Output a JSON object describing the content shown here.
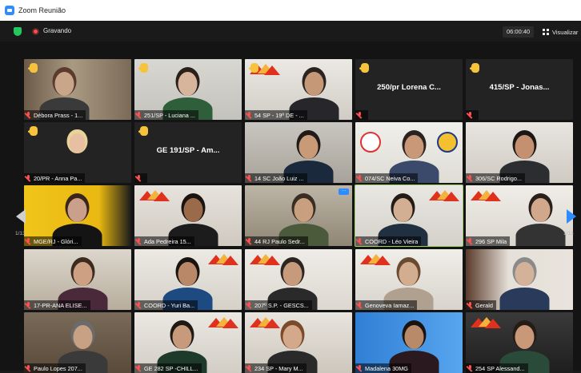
{
  "window": {
    "title": "Zoom Reunião"
  },
  "topbar": {
    "recording_label": "Gravando",
    "timer": "06:00:40",
    "view_label": "Visualizar"
  },
  "pagination": {
    "left": "1/13",
    "right": "1/13"
  },
  "colors": {
    "accent": "#2d8cff",
    "muted_mic": "#ff5050",
    "active_speaker": "#9bd35a",
    "raised_hand": "#f7c33b",
    "shield": "#23c85e"
  },
  "tiles": [
    {
      "name": "Débora Prass - 1...",
      "video": true,
      "hand": true
    },
    {
      "name": "251/SP - Luciana ...",
      "video": true,
      "hand": true
    },
    {
      "name": "54 SP - 19º DE - ...",
      "video": true,
      "hand": true
    },
    {
      "name": "250/pr Lorena C...",
      "video": false,
      "hand": true
    },
    {
      "name": "415/SP - Jonas...",
      "video": false,
      "hand": true
    },
    {
      "name": "20/PR - Anna Pa...",
      "video": true,
      "hand": true
    },
    {
      "name": "GE 191/SP - Am...",
      "video": false,
      "hand": true
    },
    {
      "name": "14 SC João Luiz ...",
      "video": true,
      "hand": false
    },
    {
      "name": "074/SC Neiva Co...",
      "video": true,
      "hand": false
    },
    {
      "name": "306/SC  Rodrigo...",
      "video": true,
      "hand": false
    },
    {
      "name": "MGE/RJ - Glóri...",
      "video": true,
      "hand": false
    },
    {
      "name": "Ada Pedreira 15...",
      "video": true,
      "hand": false
    },
    {
      "name": "44 RJ Paulo Sedr...",
      "video": true,
      "hand": false
    },
    {
      "name": "COORD - Léo Vieira",
      "video": true,
      "hand": false
    },
    {
      "name": "296 SP Mila",
      "video": true,
      "hand": false
    },
    {
      "name": "17-PR-ANA ELISE...",
      "video": true,
      "hand": false
    },
    {
      "name": "COORD - Yuri Ba...",
      "video": true,
      "hand": false
    },
    {
      "name": "207º S.P. - GESCS...",
      "video": true,
      "hand": false
    },
    {
      "name": "Genoveva Iamaz...",
      "video": true,
      "hand": false
    },
    {
      "name": "Gerald",
      "video": true,
      "hand": false
    },
    {
      "name": "Paulo Lopes  207...",
      "video": true,
      "hand": false
    },
    {
      "name": "GE 282 SP -CHILL...",
      "video": true,
      "hand": false
    },
    {
      "name": "234 SP - Mary M...",
      "video": true,
      "hand": false
    },
    {
      "name": "Madalena 30MG",
      "video": true,
      "hand": false
    },
    {
      "name": "254 SP Alessand...",
      "video": true,
      "hand": false
    }
  ]
}
